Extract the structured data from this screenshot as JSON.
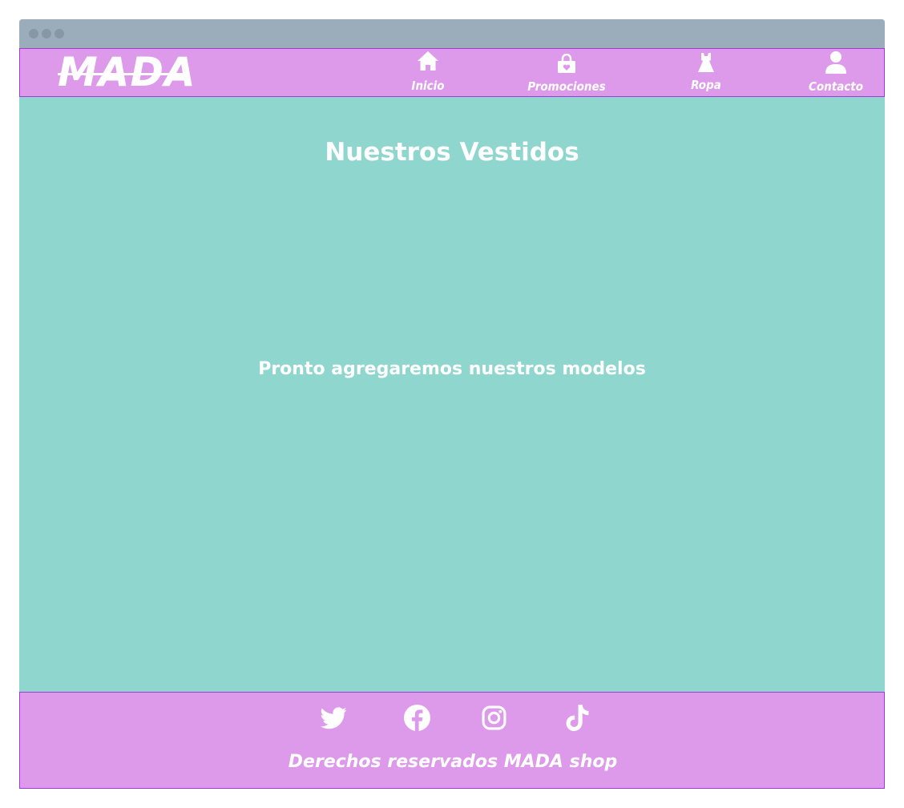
{
  "brand": {
    "name": "MADA"
  },
  "nav": {
    "items": [
      {
        "label": "Inicio",
        "icon": "home-icon"
      },
      {
        "label": "Promociones",
        "icon": "shopping-bag-icon"
      },
      {
        "label": "Ropa",
        "icon": "dress-icon"
      },
      {
        "label": "Contacto",
        "icon": "user-icon"
      }
    ]
  },
  "main": {
    "title": "Nuestros Vestidos",
    "message": "Pronto agregaremos nuestros modelos"
  },
  "footer": {
    "social": [
      {
        "icon": "twitter-icon"
      },
      {
        "icon": "facebook-icon"
      },
      {
        "icon": "instagram-icon"
      },
      {
        "icon": "tiktok-icon"
      }
    ],
    "copyright": "Derechos reservados MADA shop"
  },
  "colors": {
    "background": "#8fd6ce",
    "header": "#dd9aea",
    "border": "#a238d6",
    "text": "#ffffff",
    "titlebar": "#9badbb"
  }
}
